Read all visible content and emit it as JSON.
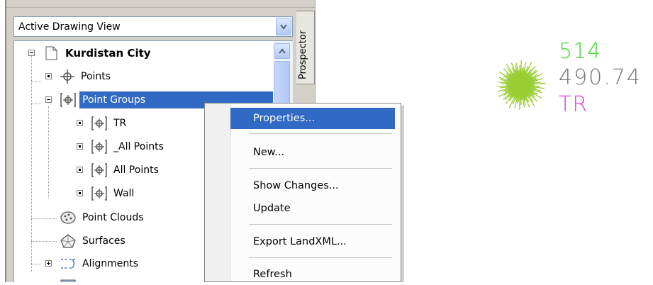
{
  "panel": {
    "view_dropdown_value": "Active Drawing View",
    "side_tab_label": "Prospector"
  },
  "tree": {
    "root": "Kurdistan City",
    "points": "Points",
    "point_groups": "Point Groups",
    "groups": [
      "TR",
      "_All Points",
      "All Points",
      "Wall"
    ],
    "point_clouds": "Point Clouds",
    "surfaces": "Surfaces",
    "alignments": "Alignments"
  },
  "context_menu": {
    "items": [
      "Properties...",
      "New...",
      "Show Changes...",
      "Update",
      "Export LandXML...",
      "Refresh"
    ],
    "highlighted": "Properties..."
  },
  "drawing": {
    "point_number": "514",
    "point_elevation": "490.74",
    "point_description": "TR",
    "colors": {
      "number": "#44dd33",
      "elevation": "#777777",
      "description": "#dd44dd",
      "tree_symbol": "#9acd32"
    }
  }
}
